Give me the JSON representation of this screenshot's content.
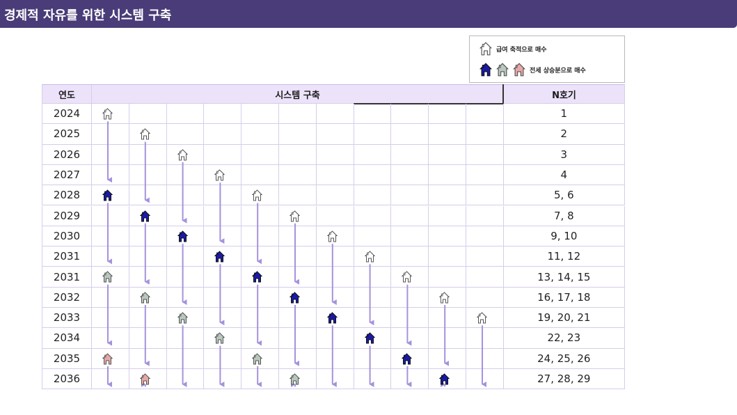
{
  "header": {
    "title": "경제적 자유를 위한 시스템 구축"
  },
  "legend": {
    "gray_label": "급여 축적으로 매수",
    "equity_label": "전세 상승분으로 매수"
  },
  "table": {
    "col_year": "연도",
    "col_system": "시스템 구축",
    "col_count": "N호기",
    "rows": [
      {
        "year": "2024",
        "count": "1",
        "houses": [
          {
            "col": 0,
            "kind": "white"
          }
        ]
      },
      {
        "year": "2025",
        "count": "2",
        "houses": [
          {
            "col": 1,
            "kind": "white"
          }
        ]
      },
      {
        "year": "2026",
        "count": "3",
        "houses": [
          {
            "col": 2,
            "kind": "white"
          }
        ]
      },
      {
        "year": "2027",
        "count": "4",
        "houses": [
          {
            "col": 3,
            "kind": "white"
          }
        ]
      },
      {
        "year": "2028",
        "count": "5, 6",
        "houses": [
          {
            "col": 0,
            "kind": "blue"
          },
          {
            "col": 4,
            "kind": "white"
          }
        ]
      },
      {
        "year": "2029",
        "count": "7, 8",
        "houses": [
          {
            "col": 1,
            "kind": "blue"
          },
          {
            "col": 5,
            "kind": "white"
          }
        ]
      },
      {
        "year": "2030",
        "count": "9, 10",
        "houses": [
          {
            "col": 2,
            "kind": "blue"
          },
          {
            "col": 6,
            "kind": "white"
          }
        ]
      },
      {
        "year": "2031",
        "count": "11, 12",
        "houses": [
          {
            "col": 3,
            "kind": "blue"
          },
          {
            "col": 7,
            "kind": "white"
          }
        ]
      },
      {
        "year": "2031",
        "count": "13, 14, 15",
        "houses": [
          {
            "col": 0,
            "kind": "green"
          },
          {
            "col": 4,
            "kind": "blue"
          },
          {
            "col": 8,
            "kind": "white"
          }
        ]
      },
      {
        "year": "2032",
        "count": "16, 17, 18",
        "houses": [
          {
            "col": 1,
            "kind": "green"
          },
          {
            "col": 5,
            "kind": "blue"
          },
          {
            "col": 9,
            "kind": "white"
          }
        ]
      },
      {
        "year": "2033",
        "count": "19, 20, 21",
        "houses": [
          {
            "col": 2,
            "kind": "green"
          },
          {
            "col": 6,
            "kind": "blue"
          },
          {
            "col": 10,
            "kind": "white"
          }
        ]
      },
      {
        "year": "2034",
        "count": "22, 23",
        "houses": [
          {
            "col": 3,
            "kind": "green"
          },
          {
            "col": 7,
            "kind": "blue"
          }
        ]
      },
      {
        "year": "2035",
        "count": "24, 25, 26",
        "houses": [
          {
            "col": 0,
            "kind": "pink"
          },
          {
            "col": 4,
            "kind": "green"
          },
          {
            "col": 8,
            "kind": "blue"
          }
        ]
      },
      {
        "year": "2036",
        "count": "27, 28, 29",
        "houses": [
          {
            "col": 1,
            "kind": "pink"
          },
          {
            "col": 5,
            "kind": "green"
          },
          {
            "col": 9,
            "kind": "blue"
          }
        ]
      }
    ]
  },
  "colors": {
    "header_bg": "#4a3c78",
    "table_header_bg": "#ece3fa",
    "arrow": "#a592dc",
    "house_white": "#ffffff",
    "house_blue": "#1a1aa8",
    "house_green": "#b9c8bf",
    "house_pink": "#e8a8a8"
  }
}
